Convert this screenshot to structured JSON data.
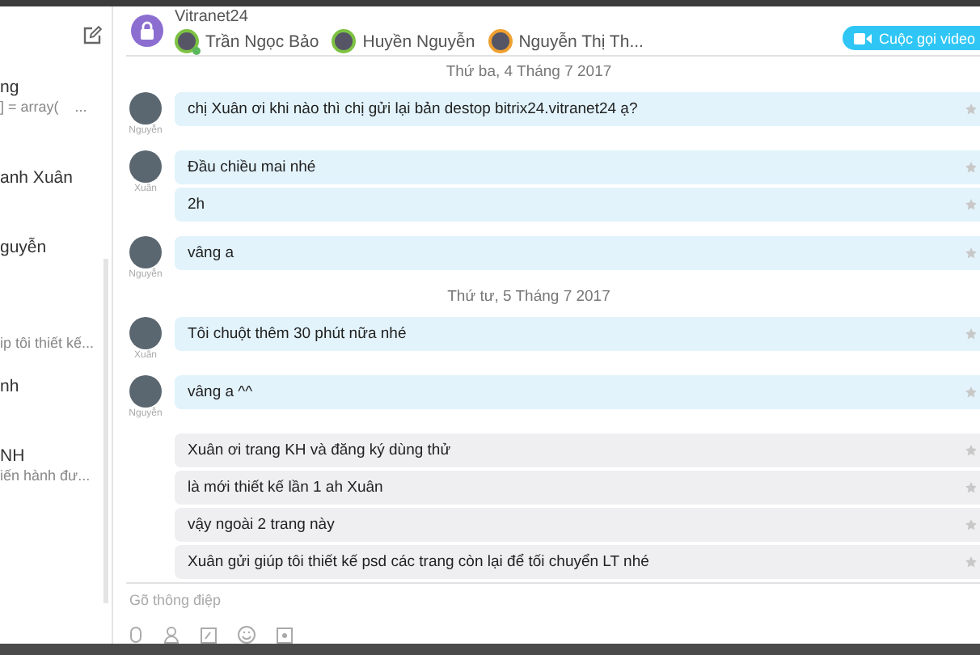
{
  "sidebar": {
    "items": [
      {
        "title": "ng",
        "preview": "] = array(",
        "extra": "..."
      },
      {
        "title": "anh Xuân"
      },
      {
        "title": "guyễn"
      },
      {
        "preview": "ip tôi thiết kế..."
      },
      {
        "title": "nh"
      },
      {
        "title": "NH",
        "preview": "iến hành đư..."
      }
    ]
  },
  "header": {
    "title": "Vitranet24",
    "members": [
      {
        "name": "Trần Ngọc Bảo",
        "color": "#7dc242",
        "online": true
      },
      {
        "name": "Huyền Nguyễn",
        "color": "#7dc242",
        "online": false
      },
      {
        "name": "Nguyễn Thị Th...",
        "color": "#f0a030",
        "online": false
      }
    ],
    "video_button": "Cuộc gọi video"
  },
  "feed": [
    {
      "kind": "date",
      "text": "Thứ ba, 4 Tháng 7 2017"
    },
    {
      "kind": "group",
      "author": "Nguyễn",
      "incoming": true,
      "messages": [
        "chị Xuân ơi khi nào thì chị gửi lại bản destop bitrix24.vitranet24 ạ?"
      ]
    },
    {
      "kind": "group",
      "author": "Xuân",
      "incoming": true,
      "messages": [
        "Đầu chiều mai nhé",
        "2h"
      ]
    },
    {
      "kind": "group",
      "author": "Nguyễn",
      "incoming": true,
      "messages": [
        "vâng a"
      ]
    },
    {
      "kind": "date",
      "text": "Thứ tư, 5 Tháng 7 2017"
    },
    {
      "kind": "group",
      "author": "Xuân",
      "incoming": true,
      "messages": [
        "Tôi chuột thêm 30 phút nữa nhé"
      ]
    },
    {
      "kind": "group",
      "author": "Nguyễn",
      "incoming": true,
      "messages": [
        "vâng a ^^"
      ]
    },
    {
      "kind": "group",
      "incoming": false,
      "messages": [
        "Xuân ơi trang KH và đăng ký dùng thử",
        "là mới thiết kế lần 1 ah Xuân",
        "vậy ngoài 2 trang này",
        "Xuân gửi giúp tôi thiết kế psd các trang còn lại để tối chuyển LT nhé"
      ]
    }
  ],
  "composer": {
    "placeholder": "Gõ thông điệp"
  }
}
